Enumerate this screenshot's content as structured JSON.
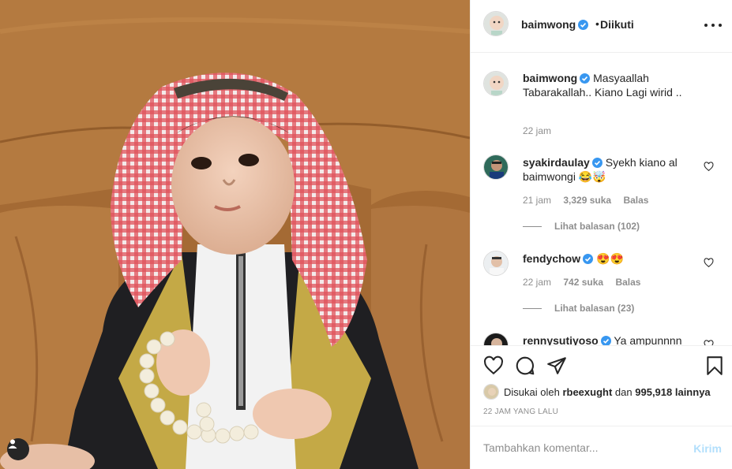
{
  "post": {
    "author": "baimwong",
    "follow_separator": "•",
    "follow_status": "Diikuti"
  },
  "caption": {
    "username": "baimwong",
    "text": "Masyaallah Tabarakallah.. Kiano Lagi wirid ..",
    "time": "22 jam"
  },
  "comments": [
    {
      "username": "syakirdaulay",
      "text": "Syekh kiano al baimwongi 😂🤯",
      "time": "21 jam",
      "likes": "3,329 suka",
      "reply_label": "Balas",
      "view_replies": "Lihat balasan (102)"
    },
    {
      "username": "fendychow",
      "text": "😍😍",
      "time": "22 jam",
      "likes": "742 suka",
      "reply_label": "Balas",
      "view_replies": "Lihat balasan (23)"
    },
    {
      "username": "rennysutiyoso",
      "text": "Ya ampunnnn"
    }
  ],
  "actions": {
    "icons": [
      "heart-icon",
      "comment-icon",
      "share-icon",
      "bookmark-icon"
    ]
  },
  "likes": {
    "prefix": "Disukai oleh",
    "user": "rbeexught",
    "connector": "dan",
    "count": "995,918 lainnya"
  },
  "timestamp": "22 JAM YANG LALU",
  "comment_box": {
    "placeholder": "Tambahkan komentar...",
    "post_label": "Kirim"
  },
  "colors": {
    "verified": "#3897f0",
    "post_button_disabled": "#b2dffc",
    "muted_text": "#8e8e8e"
  }
}
